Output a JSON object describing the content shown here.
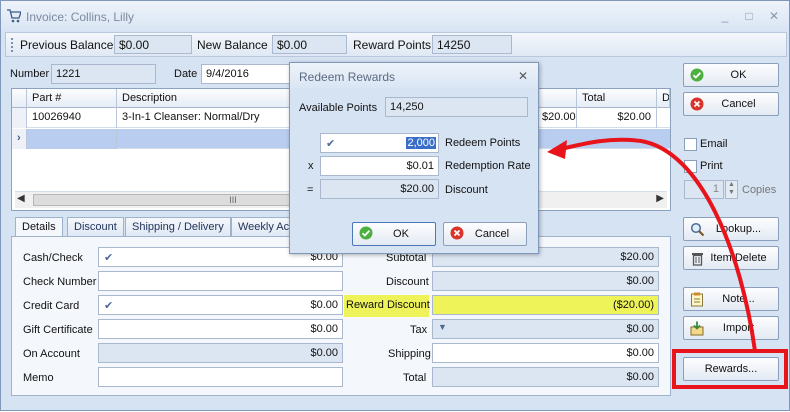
{
  "window": {
    "title": "Invoice: Collins, Lilly",
    "minimize": "_",
    "maximize": "□",
    "close": "✕"
  },
  "toolbar": {
    "previous_balance_label": "Previous Balance",
    "previous_balance": "$0.00",
    "new_balance_label": "New Balance",
    "new_balance": "$0.00",
    "reward_points_label": "Reward Points",
    "reward_points": "14250"
  },
  "header": {
    "number_label": "Number",
    "number": "1221",
    "date_label": "Date",
    "date": "9/4/2016"
  },
  "grid": {
    "columns": [
      "Part #",
      "Description",
      "Total",
      "D"
    ],
    "rows": [
      {
        "part": "10026940",
        "description": "3-In-1 Cleanser: Normal/Dry",
        "price": "$20.00",
        "total": "$20.00"
      }
    ],
    "scroll_glyph": "III"
  },
  "tabs": [
    "Details",
    "Discount",
    "Shipping / Delivery",
    "Weekly Ac"
  ],
  "details": {
    "left": [
      {
        "label": "Cash/Check",
        "value": "$0.00",
        "checked": "✔"
      },
      {
        "label": "Check Number",
        "value": ""
      },
      {
        "label": "Credit Card",
        "value": "$0.00",
        "checked": "✔"
      },
      {
        "label": "Gift Certificate",
        "value": "$0.00"
      },
      {
        "label": "On Account",
        "value": "$0.00"
      },
      {
        "label": "Memo",
        "value": ""
      }
    ],
    "right": [
      {
        "label": "Subtotal",
        "value": "$20.00"
      },
      {
        "label": "Discount",
        "value": "$0.00"
      },
      {
        "label": "Reward Discount",
        "value": "($20.00)"
      },
      {
        "label": "Tax",
        "value": "$0.00"
      },
      {
        "label": "Shipping",
        "value": "$0.00"
      },
      {
        "label": "Total",
        "value": "$0.00"
      }
    ]
  },
  "side": {
    "ok": "OK",
    "cancel": "Cancel",
    "email": "Email",
    "print": "Print",
    "copies_value": "1",
    "copies_label": "Copies",
    "lookup": "Lookup...",
    "item_delete": "Item Delete",
    "note": "Note...",
    "import": "Import",
    "rewards": "Rewards..."
  },
  "dialog": {
    "title": "Redeem Rewards",
    "close": "✕",
    "available_label": "Available Points",
    "available": "14,250",
    "redeem_points": "2,000",
    "redeem_label": "Redeem Points",
    "times": "x",
    "rate": "$0.01",
    "rate_label": "Redemption Rate",
    "equals": "=",
    "discount": "$20.00",
    "discount_label": "Discount",
    "ok": "OK",
    "cancel": "Cancel"
  },
  "colors": {
    "highlight": "#eef35a",
    "annotation": "#e8141b",
    "selected_row": "#b9cdf0"
  }
}
